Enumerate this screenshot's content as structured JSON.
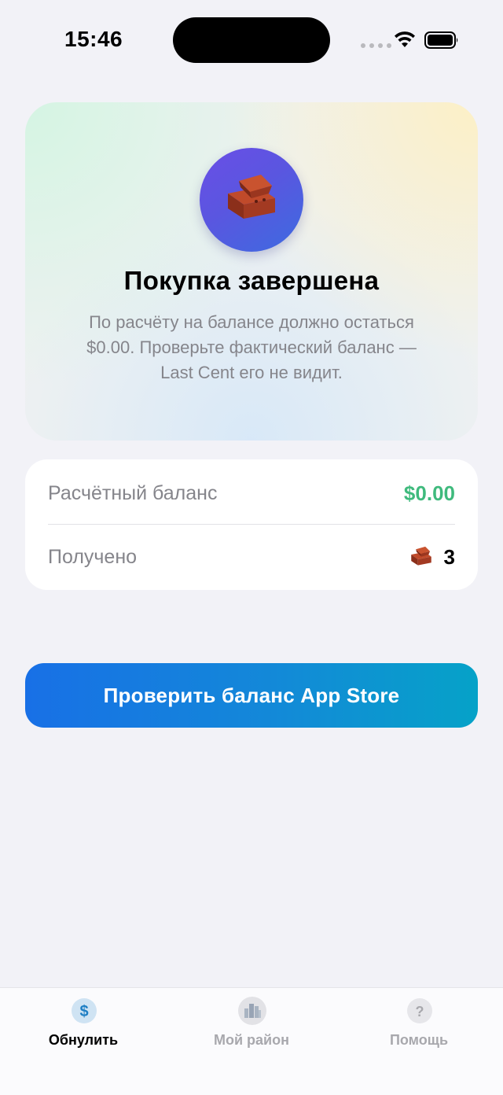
{
  "status_bar": {
    "time": "15:46"
  },
  "hero": {
    "title": "Покупка завершена",
    "description": "По расчёту на балансе должно остаться $0.00. Проверьте фактический баланс — Last Cent его не видит.",
    "icon": "brick-icon"
  },
  "summary": {
    "balance_label": "Расчётный баланс",
    "balance_value": "$0.00",
    "received_label": "Получено",
    "received_count": "3",
    "received_icon": "brick-icon"
  },
  "actions": {
    "check_balance_label": "Проверить баланс App Store"
  },
  "tab_bar": {
    "tabs": [
      {
        "label": "Обнулить",
        "icon": "dollar-icon",
        "active": true
      },
      {
        "label": "Мой район",
        "icon": "city-icon",
        "active": false
      },
      {
        "label": "Помощь",
        "icon": "question-icon",
        "active": false
      }
    ]
  },
  "colors": {
    "accent_green": "#3fba7d",
    "button_start": "#1870e6",
    "button_end": "#06a2c8",
    "icon_circle": "#5a56e0",
    "background": "#f2f2f7"
  }
}
